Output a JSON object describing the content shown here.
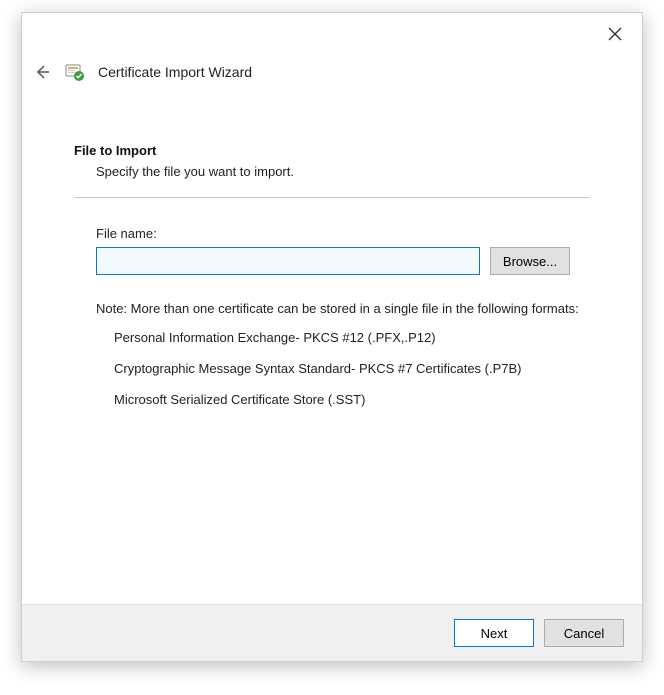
{
  "header": {
    "title": "Certificate Import Wizard"
  },
  "section": {
    "heading": "File to Import",
    "subtext": "Specify the file you want to import."
  },
  "file": {
    "label": "File name:",
    "value": "",
    "browse_label": "Browse..."
  },
  "note": {
    "prefix": "Note:  More than one certificate can be stored in a single file in the following formats:",
    "formats": [
      "Personal Information Exchange- PKCS #12 (.PFX,.P12)",
      "Cryptographic Message Syntax Standard- PKCS #7 Certificates (.P7B)",
      "Microsoft Serialized Certificate Store (.SST)"
    ]
  },
  "footer": {
    "next_label": "Next",
    "cancel_label": "Cancel"
  }
}
